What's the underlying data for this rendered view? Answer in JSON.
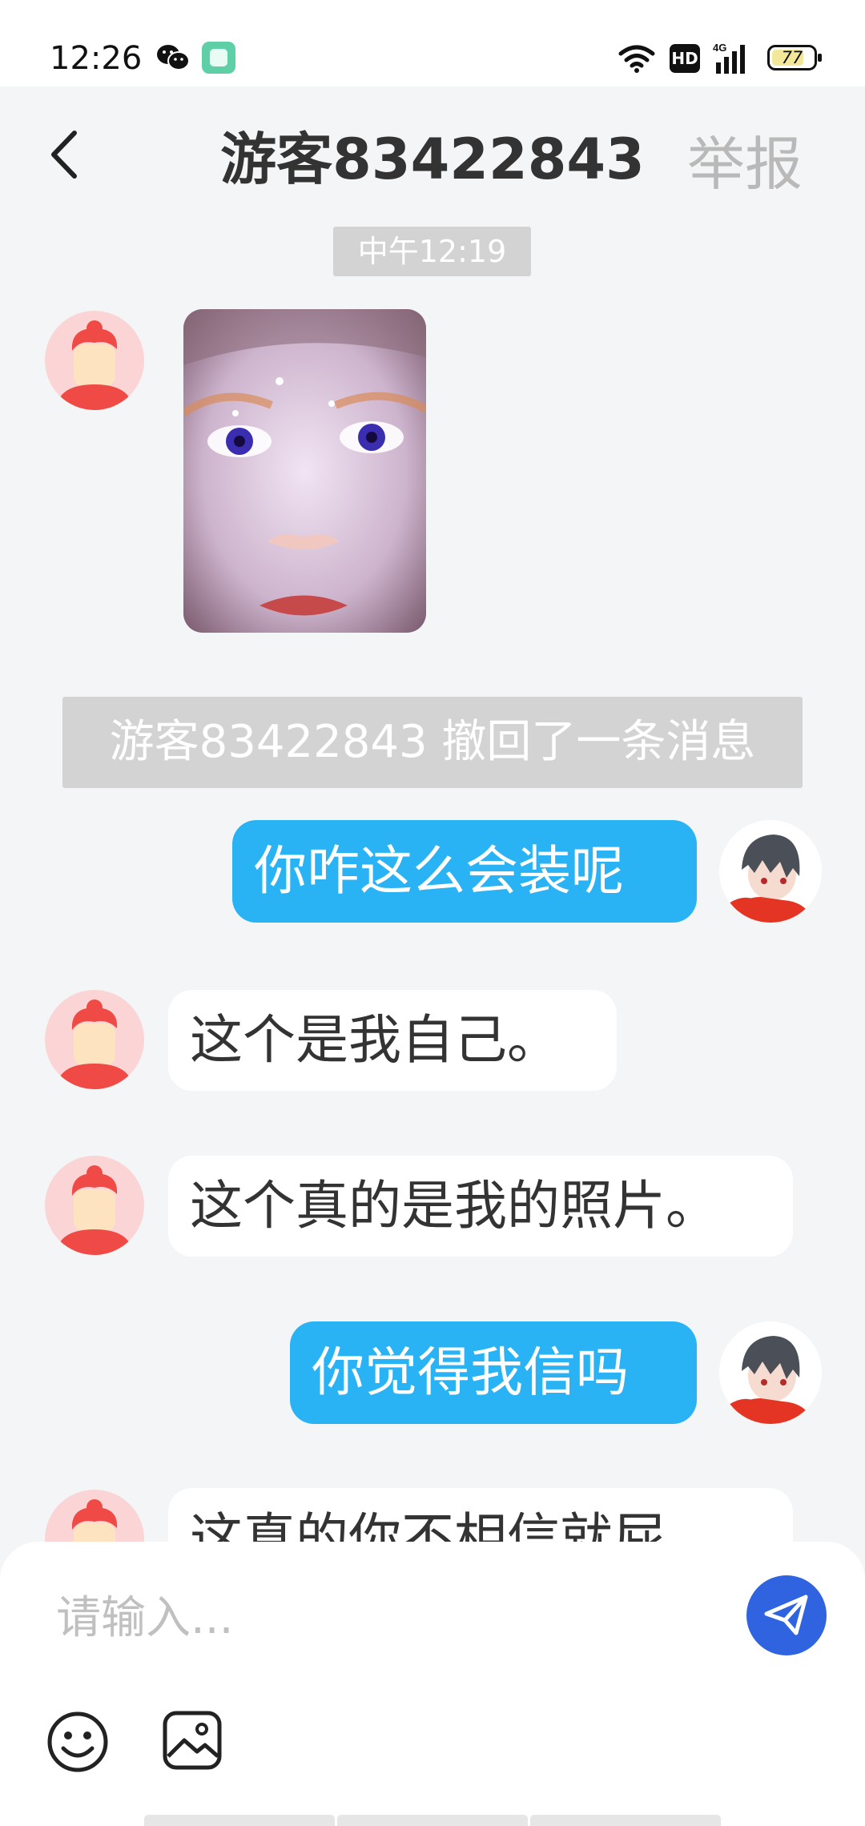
{
  "status_bar": {
    "time": "12:26",
    "network_badge": "HD",
    "signal_label": "4G",
    "battery_level": "77"
  },
  "header": {
    "title": "游客83422843",
    "report_label": "举报"
  },
  "chat": {
    "timestamp": "中午12:19",
    "recall_notice": "游客83422843 撤回了一条消息",
    "messages": [
      {
        "side": "outgoing",
        "text": "你咋这么会装呢"
      },
      {
        "side": "incoming",
        "text": "这个是我自己。"
      },
      {
        "side": "incoming",
        "text": "这个真的是我的照片。"
      },
      {
        "side": "outgoing",
        "text": "你觉得我信吗"
      },
      {
        "side": "incoming",
        "text": "这真的你不相信就屁"
      }
    ]
  },
  "composer": {
    "placeholder": "请输入..."
  },
  "colors": {
    "outgoing_bubble": "#29b3f5",
    "send_button": "#2f63e0",
    "page_background": "#f4f5f7"
  }
}
